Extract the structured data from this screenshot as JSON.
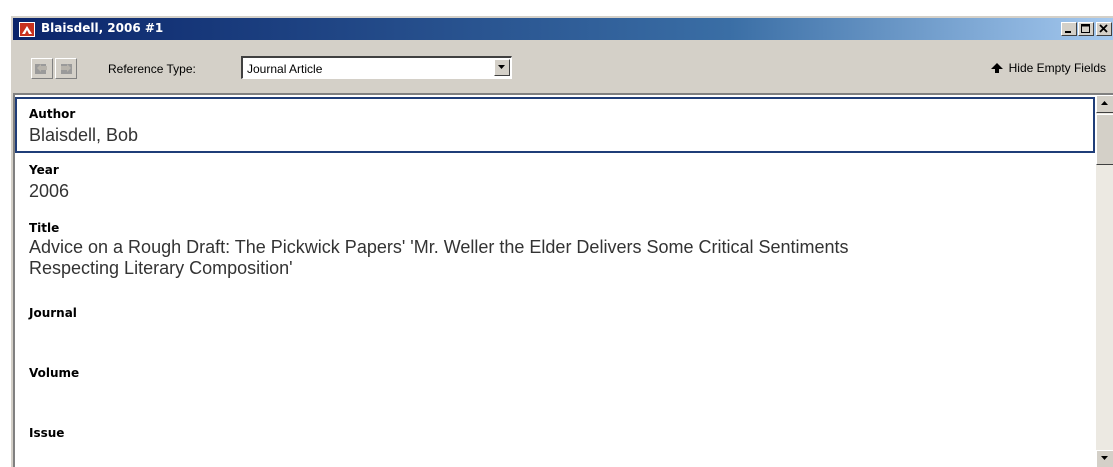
{
  "window": {
    "title": "Blaisdell, 2006 #1",
    "minimize_icon": "minimize-icon",
    "maximize_icon": "maximize-icon",
    "close_icon": "close-icon"
  },
  "toolbar": {
    "reference_type_label": "Reference Type:",
    "reference_type_value": "Journal Article",
    "hide_empty_fields_label": "Hide Empty Fields",
    "icons": [
      "previous-reference-icon",
      "next-reference-icon",
      "dropdown-arrow-icon",
      "hide-arrow-icon"
    ]
  },
  "fields": [
    {
      "label": "Author",
      "value": "Blaisdell, Bob"
    },
    {
      "label": "Year",
      "value": "2006"
    },
    {
      "label": "Title",
      "value_lines": [
        "Advice on a Rough Draft: The Pickwick Papers' 'Mr. Weller the Elder Delivers Some Critical Sentiments",
        "Respecting Literary Composition'"
      ]
    },
    {
      "label": "Journal",
      "value": ""
    },
    {
      "label": "Volume",
      "value": ""
    },
    {
      "label": "Issue",
      "value": ""
    }
  ]
}
